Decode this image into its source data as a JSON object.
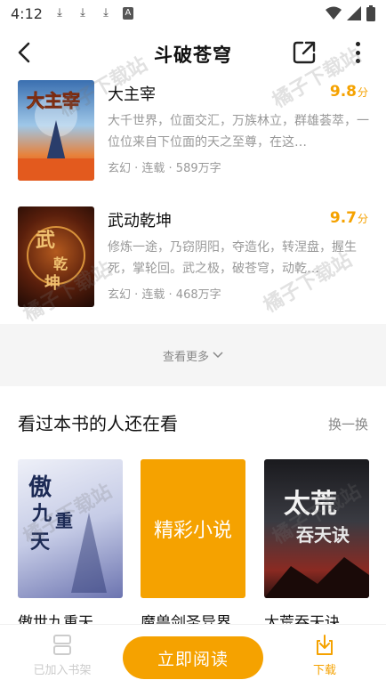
{
  "status_bar": {
    "time": "4:12"
  },
  "header": {
    "title": "斗破苍穹"
  },
  "books": [
    {
      "title": "大主宰",
      "score": "9.8",
      "score_unit": "分",
      "description": "大千世界，位面交汇，万族林立，群雄荟萃，一位位来自下位面的天之至尊，在这…",
      "meta": "玄幻 · 连载 · 589万字",
      "cover_text": "大主宰"
    },
    {
      "title": "武动乾坤",
      "score": "9.7",
      "score_unit": "分",
      "description": "修炼一途，乃窃阴阳，夺造化，转涅盘，握生死，掌轮回。武之极，破苍穹，动乾…",
      "meta": "玄幻 · 连载 · 468万字",
      "cover_text": "武动乾坤"
    }
  ],
  "more": {
    "label": "查看更多"
  },
  "recommend": {
    "title": "看过本书的人还在看",
    "switch_label": "换一换",
    "books": [
      {
        "name": "傲世九重天",
        "cover_text": "傲世九重天"
      },
      {
        "name": "魔兽剑圣异界",
        "cover_text": "精彩小说"
      },
      {
        "name": "太荒吞天诀",
        "cover_text": "太荒吞天诀"
      }
    ]
  },
  "bottom_bar": {
    "shelf_label": "已加入书架",
    "read_label": "立即阅读",
    "download_label": "下载"
  },
  "watermark": {
    "text": "橘子下载站"
  },
  "colors": {
    "accent": "#f5a200",
    "muted": "#999999"
  }
}
